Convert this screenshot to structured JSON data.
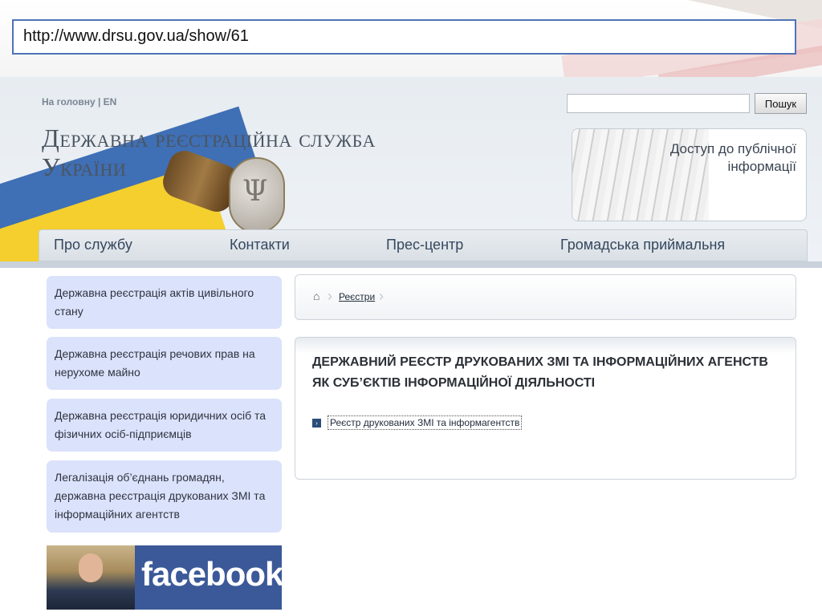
{
  "slide": {
    "url": "http://www.drsu.gov.ua/show/61"
  },
  "header": {
    "top_links": "На головну | EN",
    "site_title_line1": "Державна реєстраційна служба",
    "site_title_line2": "України",
    "search_button": "Пошук",
    "search_value": "",
    "access_line1": "Доступ до публічної",
    "access_line2": "інформації"
  },
  "menu": {
    "items": [
      "Про службу",
      "Контакти",
      "Прес-центр",
      "Громадська приймальня"
    ]
  },
  "sidebar": {
    "items": [
      "Державна реєстрація актів цивільного стану",
      "Державна реєстрація речових прав на нерухоме майно",
      "Державна реєстрація юридичних осіб та фізичних осіб-підприємців",
      "Легалізація об’єднань громадян, державна реєстрація друкованих ЗМІ та інформаційних агентств"
    ],
    "facebook_label": "facebook"
  },
  "breadcrumb": {
    "current": "Реєстри"
  },
  "main": {
    "title": "ДЕРЖАВНИЙ РЕЄСТР ДРУКОВАНИХ ЗМІ ТА ІНФОРМАЦІЙНИХ АГЕНСТВ ЯК СУБ’ЄКТІВ ІНФОРМАЦІЙНОЇ ДІЯЛЬНОСТІ",
    "link": "Реєстр друкованих ЗМІ та інформагентств"
  }
}
